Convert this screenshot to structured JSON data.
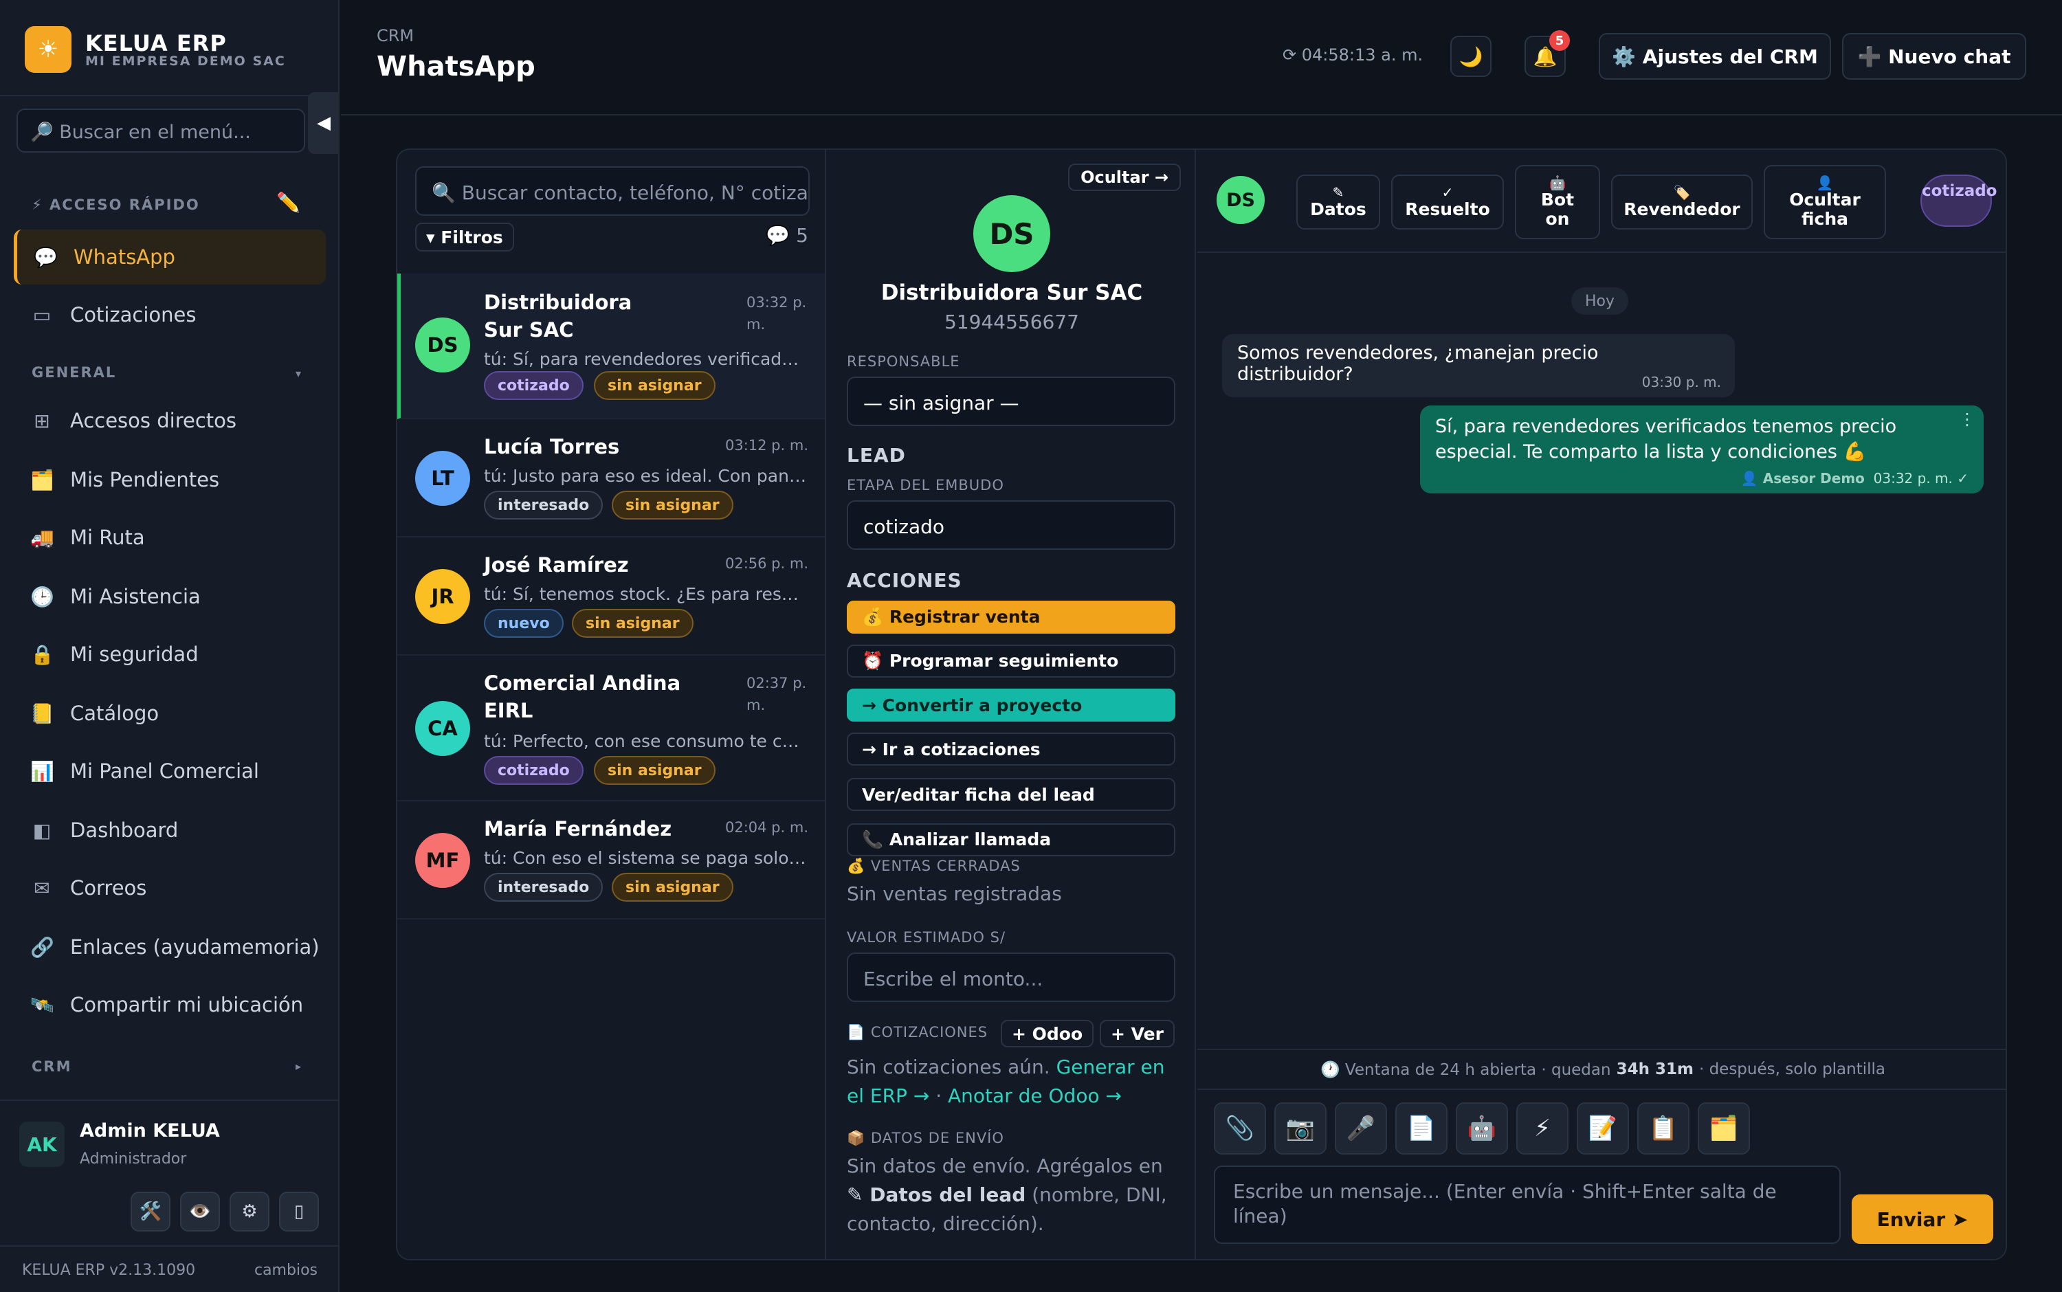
{
  "sidebar": {
    "brand_title": "KELUA ERP",
    "brand_subtitle": "MI EMPRESA DEMO SAC",
    "logo_icon": "☀",
    "search_placeholder": "🔎 Buscar en el menú...",
    "collapse_icon": "◀",
    "quick_access_label": "⚡ ACCESO RÁPIDO",
    "edit_icon": "✏️",
    "quick_items": [
      {
        "label": "WhatsApp",
        "icon": "💬",
        "active": true
      },
      {
        "label": "Cotizaciones",
        "icon": "▭"
      }
    ],
    "general_label": "GENERAL",
    "general_chevron": "▾",
    "general_items": [
      {
        "label": "Accesos directos",
        "icon": "⊞"
      },
      {
        "label": "Mis Pendientes",
        "icon": "🗂️"
      },
      {
        "label": "Mi Ruta",
        "icon": "🚚"
      },
      {
        "label": "Mi Asistencia",
        "icon": "🕒"
      },
      {
        "label": "Mi seguridad",
        "icon": "🔒"
      },
      {
        "label": "Catálogo",
        "icon": "📒"
      },
      {
        "label": "Mi Panel Comercial",
        "icon": "📊"
      },
      {
        "label": "Dashboard",
        "icon": "◧"
      },
      {
        "label": "Correos",
        "icon": "✉"
      },
      {
        "label": "Enlaces (ayudamemoria)",
        "icon": "🔗"
      },
      {
        "label": "Compartir mi ubicación",
        "icon": "🛰️"
      }
    ],
    "crm_label": "CRM",
    "crm_chevron": "▸",
    "user": {
      "initials": "AK",
      "name": "Admin KELUA",
      "role": "Administrador"
    },
    "user_tools": [
      "🛠️",
      "👁️",
      "⚙",
      "▯"
    ],
    "version": "KELUA ERP v2.13.1090",
    "changes": "cambios"
  },
  "header": {
    "breadcrumb": "CRM",
    "title": "WhatsApp",
    "clock": "⟳ 04:58:13 a. m.",
    "theme_icon": "🌙",
    "bell_icon": "🔔",
    "notif_count": "5",
    "settings_button": "⚙️ Ajustes del CRM",
    "new_chat_button": "➕ Nuevo chat"
  },
  "list": {
    "search_placeholder": "🔍 Buscar contacto, teléfono, N° cotización",
    "filters": "▾ Filtros",
    "count": "💬 5",
    "conversations": [
      {
        "initials": "DS",
        "color": "#4ade80",
        "name": "Distribuidora Sur SAC",
        "time": "03:32 p. m.",
        "preview": "tú: Sí, para revendedores verificados tenemos precio especial",
        "tags": [
          {
            "label": "cotizado",
            "kind": "cot"
          },
          {
            "label": "sin asignar",
            "kind": "sin"
          }
        ]
      },
      {
        "initials": "LT",
        "color": "#60a5fa",
        "name": "Lucía Torres",
        "time": "03:12 p. m.",
        "preview": "tú: Justo para eso es ideal. Con panel de control",
        "tags": [
          {
            "label": "interesado",
            "kind": "int"
          },
          {
            "label": "sin asignar",
            "kind": "sin"
          }
        ]
      },
      {
        "initials": "JR",
        "color": "#fbbf24",
        "name": "José Ramírez",
        "time": "02:56 p. m.",
        "preview": "tú: Sí, tenemos stock. ¿Es para respaldo?",
        "tags": [
          {
            "label": "nuevo",
            "kind": "nue"
          },
          {
            "label": "sin asignar",
            "kind": "sin"
          }
        ]
      },
      {
        "initials": "CA",
        "color": "#2dd4bf",
        "name": "Comercial Andina EIRL",
        "time": "02:37 p. m.",
        "preview": "tú: Perfecto, con ese consumo te conviene",
        "tags": [
          {
            "label": "cotizado",
            "kind": "cot"
          },
          {
            "label": "sin asignar",
            "kind": "sin"
          }
        ]
      },
      {
        "initials": "MF",
        "color": "#f87171",
        "name": "María Fernández",
        "time": "02:04 p. m.",
        "preview": "tú: Con eso el sistema se paga solo en meses",
        "tags": [
          {
            "label": "interesado",
            "kind": "int"
          },
          {
            "label": "sin asignar",
            "kind": "sin"
          }
        ]
      }
    ]
  },
  "detail": {
    "hide_button": "Ocultar →",
    "initials": "DS",
    "name": "Distribuidora Sur SAC",
    "phone": "51944556677",
    "responsable_label": "RESPONSABLE",
    "responsable_value": "— sin asignar —",
    "lead_header": "LEAD",
    "stage_label": "ETAPA DEL EMBUDO",
    "stage_value": "cotizado",
    "actions_header": "ACCIONES",
    "actions": {
      "register_sale": "💰 Registrar venta",
      "schedule": "⏰ Programar seguimiento",
      "convert": "→ Convertir a proyecto",
      "go_quotes": "→ Ir a cotizaciones",
      "edit_lead": "Ver/editar ficha del lead",
      "analyze_call": "📞 Analizar llamada"
    },
    "closed_sales_label": "💰 VENTAS CERRADAS",
    "closed_sales_empty": "Sin ventas registradas",
    "estimated_label": "VALOR ESTIMADO S/",
    "estimated_placeholder": "Escribe el monto...",
    "quotes_label": "📄 COTIZACIONES",
    "odoo_button": "+ Odoo",
    "ver_button": "+ Ver",
    "quotes_empty": "Sin cotizaciones aún.",
    "generate_link": "Generar en el ERP →",
    "separator": "·",
    "odoo_link": "Anotar de Odoo →",
    "shipping_label": "📦 DATOS DE ENVÍO",
    "shipping_text_a": "Sin datos de envío. Agrégalos en",
    "shipping_link": "✎ Datos del lead",
    "shipping_text_b": "(nombre, DNI, contacto, dirección)."
  },
  "chat": {
    "initials": "DS",
    "toolbar": [
      {
        "icon": "✎",
        "label": "Datos"
      },
      {
        "icon": "✓",
        "label": "Resuelto"
      },
      {
        "icon": "🤖",
        "label": "Bot on"
      },
      {
        "icon": "🏷️",
        "label": "Revendedor"
      },
      {
        "icon": "👤",
        "label": "Ocultar ficha"
      }
    ],
    "status_chip": "cotizado",
    "day": "Hoy",
    "incoming": {
      "text": "Somos revendedores, ¿manejan precio distribuidor?",
      "time": "03:30 p. m."
    },
    "outgoing": {
      "text": "Sí, para revendedores verificados tenemos precio especial. Te comparto la lista y condiciones 💪",
      "author": "👤 Asesor Demo",
      "time": "03:32 p. m. ✓"
    },
    "window_prefix": "🕐 Ventana de 24 h abierta · quedan",
    "window_remaining": "34h 31m",
    "window_suffix": "· después, solo plantilla",
    "tools": [
      "📎",
      "📷",
      "🎤",
      "📄",
      "🤖",
      "⚡",
      "📝",
      "📋",
      "🗂️"
    ],
    "composer_placeholder": "Escribe un mensaje...  (Enter envía · Shift+Enter salta de línea)",
    "send_button": "Enviar ➤"
  }
}
